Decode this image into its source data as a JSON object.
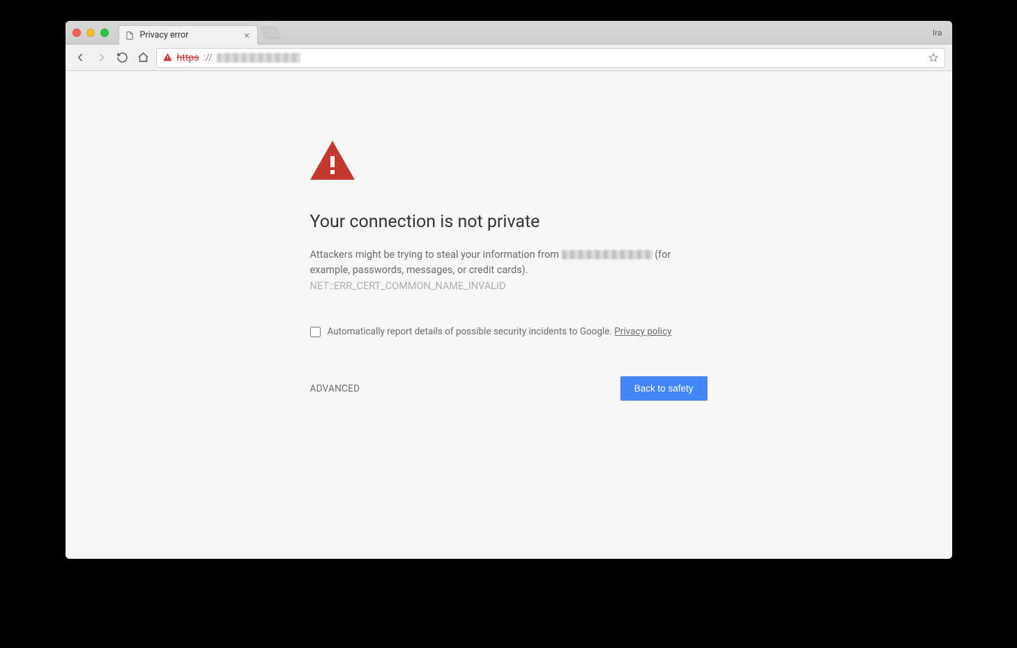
{
  "window": {
    "profile_name": "Ira"
  },
  "tab": {
    "title": "Privacy error"
  },
  "address_bar": {
    "scheme": "https",
    "separator": "://"
  },
  "warning": {
    "heading": "Your connection is not private",
    "body_prefix": "Attackers might be trying to steal your information from ",
    "body_suffix": " (for example, passwords, messages, or credit cards). ",
    "error_code": "NET::ERR_CERT_COMMON_NAME_INVALID"
  },
  "report": {
    "label": "Automatically report details of possible security incidents to Google. ",
    "link_text": "Privacy policy"
  },
  "actions": {
    "advanced": "ADVANCED",
    "primary": "Back to safety"
  }
}
